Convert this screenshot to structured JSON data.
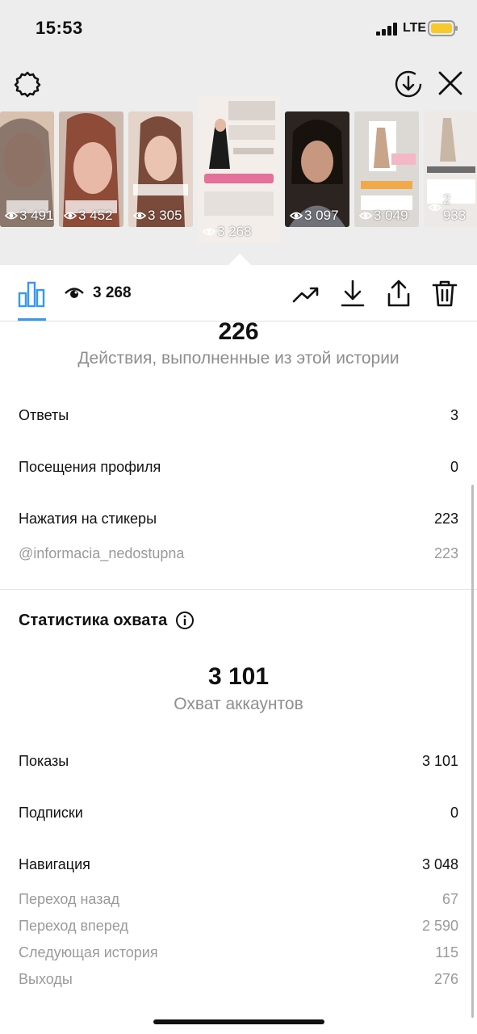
{
  "status_bar": {
    "time": "15:53",
    "network": "LTE"
  },
  "stories": [
    {
      "views": "3 491",
      "colors": [
        "#6b5a52",
        "#d9c1b0",
        "#2f2724"
      ]
    },
    {
      "views": "3 452",
      "colors": [
        "#9c6f5d",
        "#d7b3a4",
        "#4a2d24"
      ]
    },
    {
      "views": "3 305",
      "colors": [
        "#a88676",
        "#e9d5c9",
        "#5a3b30"
      ]
    },
    {
      "views": "3 268",
      "active": true,
      "colors": [
        "#f1ebe7",
        "#1b1b1b",
        "#e06a8a"
      ]
    },
    {
      "views": "3 097",
      "colors": [
        "#2b2420",
        "#c29a86",
        "#8c8d92"
      ]
    },
    {
      "views": "3 049",
      "colors": [
        "#d8d4cf",
        "#b0865e",
        "#eeeeee"
      ]
    },
    {
      "views": "2 933",
      "colors": [
        "#e6e3df",
        "#bdb3a8",
        "#f4f4f4"
      ]
    }
  ],
  "active_story_text": "@INFORMACIA_NEDOSTUPNA",
  "toolbar": {
    "views": "3 268"
  },
  "interactions": {
    "total": "226",
    "caption": "Действия, выполненные из этой истории",
    "rows": [
      {
        "label": "Ответы",
        "value": "3"
      },
      {
        "label": "Посещения профиля",
        "value": "0"
      },
      {
        "label": "Нажатия на стикеры",
        "value": "223"
      }
    ],
    "sticker_detail": {
      "label": "@informacia_nedostupna",
      "value": "223"
    }
  },
  "reach": {
    "title": "Статистика охвата",
    "total": "3 101",
    "caption": "Охват аккаунтов",
    "rows": [
      {
        "label": "Показы",
        "value": "3 101"
      },
      {
        "label": "Подписки",
        "value": "0"
      },
      {
        "label": "Навигация",
        "value": "3 048"
      }
    ],
    "navigation_details": [
      {
        "label": "Переход назад",
        "value": "67"
      },
      {
        "label": "Переход вперед",
        "value": "2 590"
      },
      {
        "label": "Следующая история",
        "value": "115"
      },
      {
        "label": "Выходы",
        "value": "276"
      }
    ]
  },
  "colors": {
    "accent": "#3897f0",
    "muted": "#8e8e8e"
  }
}
